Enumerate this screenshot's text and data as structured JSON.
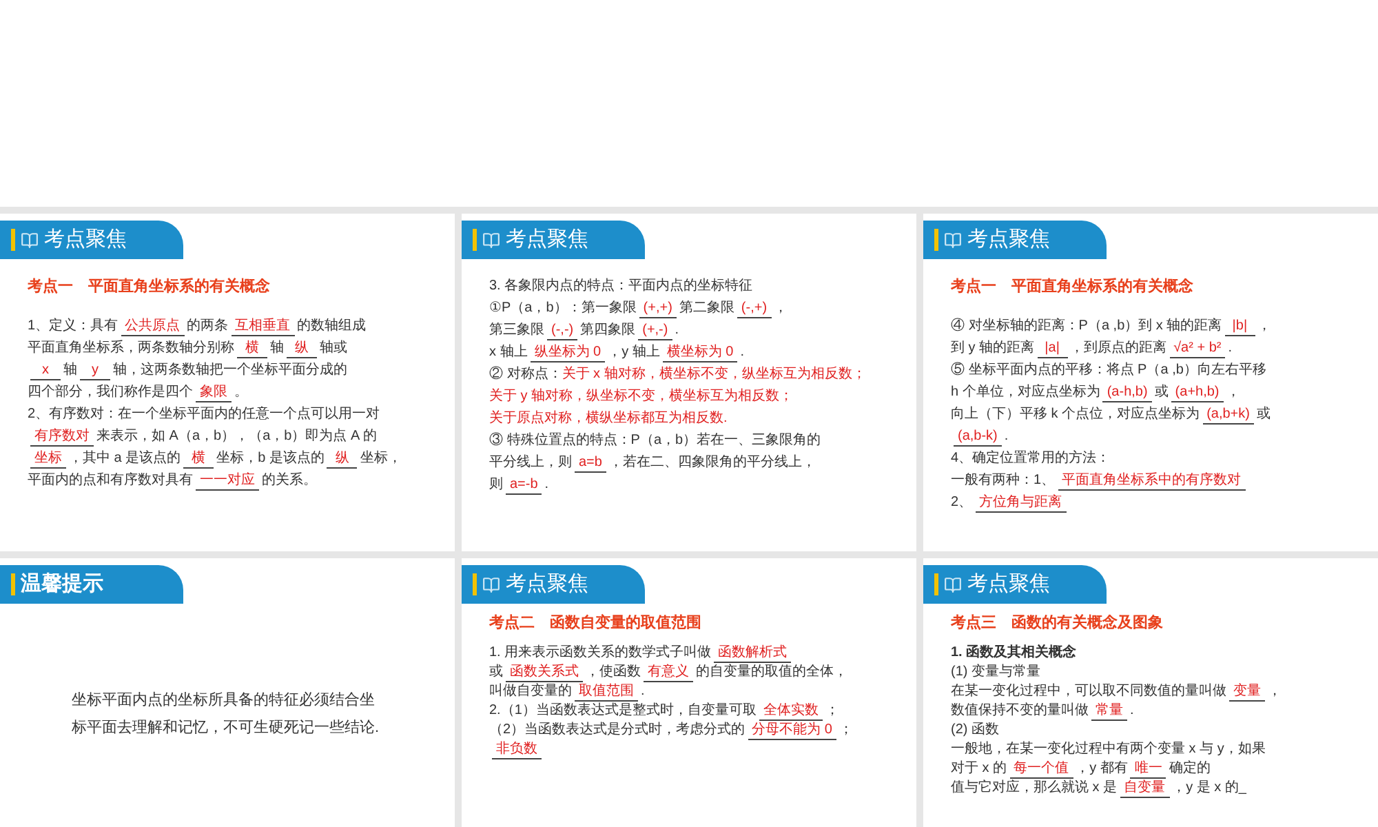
{
  "slides": [
    {
      "title": "考点聚焦",
      "book_icon": true,
      "subtitle": "考点一　平面直角坐标系的有关概念",
      "lines": [
        {
          "segments": [
            {
              "kind": "text",
              "text": "1、定义：具有"
            },
            {
              "kind": "blank",
              "answer": "公共原点"
            },
            {
              "kind": "text",
              "text": "的两条"
            },
            {
              "kind": "blank",
              "answer": "互相垂直"
            },
            {
              "kind": "text",
              "text": "的数轴组成"
            }
          ]
        },
        {
          "segments": [
            {
              "kind": "text",
              "text": "平面直角坐标系，两条数轴分别称"
            },
            {
              "kind": "blank",
              "answer": "横"
            },
            {
              "kind": "text",
              "text": "轴"
            },
            {
              "kind": "blank",
              "answer": "纵"
            },
            {
              "kind": "text",
              "text": "轴或"
            }
          ]
        },
        {
          "segments": [
            {
              "kind": "blank",
              "answer": "x"
            },
            {
              "kind": "text",
              "text": "轴"
            },
            {
              "kind": "blank",
              "answer": "y"
            },
            {
              "kind": "text",
              "text": "轴，这两条数轴把一个坐标平面分成的"
            }
          ]
        },
        {
          "segments": [
            {
              "kind": "text",
              "text": "四个部分，我们称作是四个"
            },
            {
              "kind": "blank",
              "answer": "象限"
            },
            {
              "kind": "text",
              "text": "。"
            }
          ]
        },
        {
          "segments": [
            {
              "kind": "text",
              "text": "2、有序数对：在一个坐标平面内的任意一个点可以用一对"
            }
          ]
        },
        {
          "segments": [
            {
              "kind": "blank",
              "answer": "有序数对"
            },
            {
              "kind": "text",
              "text": "来表示，如 A（a，b），（a，b）即为点 A 的"
            }
          ]
        },
        {
          "segments": [
            {
              "kind": "blank",
              "answer": "坐标"
            },
            {
              "kind": "text",
              "text": "，其中 a 是该点的"
            },
            {
              "kind": "blank",
              "answer": "横"
            },
            {
              "kind": "text",
              "text": "坐标，b 是该点的"
            },
            {
              "kind": "blank",
              "answer": "纵"
            },
            {
              "kind": "text",
              "text": "坐标，"
            }
          ]
        },
        {
          "segments": [
            {
              "kind": "text",
              "text": "平面内的点和有序数对具有"
            },
            {
              "kind": "blank",
              "answer": "一一对应"
            },
            {
              "kind": "text",
              "text": "的关系。"
            }
          ]
        }
      ]
    },
    {
      "title": "考点聚焦",
      "book_icon": true,
      "lines": [
        {
          "segments": [
            {
              "kind": "text",
              "text": "3. 各象限内点的特点：平面内点的坐标特征"
            }
          ]
        },
        {
          "segments": [
            {
              "kind": "text",
              "text": "①P（a，b）：第一象限"
            },
            {
              "kind": "blank",
              "answer": "(+,+)"
            },
            {
              "kind": "text",
              "text": "第二象限"
            },
            {
              "kind": "blank",
              "answer": "(-,+)"
            },
            {
              "kind": "text",
              "text": "，"
            }
          ]
        },
        {
          "segments": [
            {
              "kind": "text",
              "text": "第三象限"
            },
            {
              "kind": "blank",
              "answer": "(-,-)"
            },
            {
              "kind": "text",
              "text": "第四象限"
            },
            {
              "kind": "blank",
              "answer": "(+,-)"
            },
            {
              "kind": "text",
              "text": "."
            }
          ]
        },
        {
          "segments": [
            {
              "kind": "text",
              "text": "x 轴上"
            },
            {
              "kind": "blank",
              "answer": "纵坐标为 0"
            },
            {
              "kind": "text",
              "text": "，y 轴上"
            },
            {
              "kind": "blank",
              "answer": "横坐标为 0"
            },
            {
              "kind": "text",
              "text": "."
            }
          ]
        },
        {
          "segments": [
            {
              "kind": "text",
              "text": "② 对称点："
            },
            {
              "kind": "red",
              "text": "关于 x 轴对称，横坐标不变，纵坐标互为相反数；"
            }
          ]
        },
        {
          "segments": [
            {
              "kind": "red",
              "text": "关于 y 轴对称，纵坐标不变，横坐标互为相反数；"
            }
          ]
        },
        {
          "segments": [
            {
              "kind": "red",
              "text": "关于原点对称，横纵坐标都互为相反数."
            }
          ]
        },
        {
          "segments": [
            {
              "kind": "text",
              "text": "③ 特殊位置点的特点：P（a，b）若在一、三象限角的"
            }
          ]
        },
        {
          "segments": [
            {
              "kind": "text",
              "text": "平分线上，则"
            },
            {
              "kind": "blank",
              "answer": "a=b"
            },
            {
              "kind": "text",
              "text": "，若在二、四象限角的平分线上，"
            }
          ]
        },
        {
          "segments": [
            {
              "kind": "text",
              "text": "则"
            },
            {
              "kind": "blank",
              "answer": "a=-b"
            },
            {
              "kind": "text",
              "text": "."
            }
          ]
        }
      ]
    },
    {
      "title": "考点聚焦",
      "book_icon": true,
      "subtitle": "考点一　平面直角坐标系的有关概念",
      "lines": [
        {
          "segments": [
            {
              "kind": "text",
              "text": "④ 对坐标轴的距离：P（a ,b）到 x 轴的距离"
            },
            {
              "kind": "blank",
              "answer": "|b|"
            },
            {
              "kind": "text",
              "text": "，"
            }
          ]
        },
        {
          "segments": [
            {
              "kind": "text",
              "text": "到 y 轴的距离"
            },
            {
              "kind": "blank",
              "answer": "|a|"
            },
            {
              "kind": "text",
              "text": "，到原点的距离"
            },
            {
              "kind": "blank",
              "answer": "√a² + b²"
            },
            {
              "kind": "text",
              "text": "."
            }
          ]
        },
        {
          "segments": [
            {
              "kind": "text",
              "text": "⑤ 坐标平面内点的平移：将点 P（a ,b）向左右平移"
            }
          ]
        },
        {
          "segments": [
            {
              "kind": "text",
              "text": "h 个单位，对应点坐标为"
            },
            {
              "kind": "blank",
              "answer": "(a-h,b)"
            },
            {
              "kind": "text",
              "text": "或"
            },
            {
              "kind": "blank",
              "answer": "(a+h,b)"
            },
            {
              "kind": "text",
              "text": "，"
            }
          ]
        },
        {
          "segments": [
            {
              "kind": "text",
              "text": "向上（下）平移 k 个点位，对应点坐标为"
            },
            {
              "kind": "blank",
              "answer": "(a,b+k)"
            },
            {
              "kind": "text",
              "text": "或"
            }
          ]
        },
        {
          "segments": [
            {
              "kind": "blank",
              "answer": "(a,b-k)"
            },
            {
              "kind": "text",
              "text": "."
            }
          ]
        },
        {
          "segments": [
            {
              "kind": "text",
              "text": "4、确定位置常用的方法："
            }
          ]
        },
        {
          "segments": [
            {
              "kind": "text",
              "text": "一般有两种：1、"
            },
            {
              "kind": "blank",
              "answer": "平面直角坐标系中的有序数对"
            }
          ]
        },
        {
          "segments": [
            {
              "kind": "text",
              "text": "2、"
            },
            {
              "kind": "blank",
              "answer": "方位角与距离"
            }
          ]
        }
      ]
    },
    {
      "title": "温馨提示",
      "book_icon": false,
      "lines": [
        {
          "segments": [
            {
              "kind": "text",
              "text": "坐标平面内点的坐标所具备的特征必须结合坐标平面去理解和记忆，不可生硬死记一些结论."
            }
          ]
        }
      ]
    },
    {
      "title": "考点聚焦",
      "book_icon": true,
      "subtitle": "考点二　函数自变量的取值范围",
      "lines": [
        {
          "segments": [
            {
              "kind": "text",
              "text": "1. 用来表示函数关系的数学式子叫做"
            },
            {
              "kind": "blank",
              "answer": "函数解析式"
            }
          ]
        },
        {
          "segments": [
            {
              "kind": "text",
              "text": "或"
            },
            {
              "kind": "blank",
              "answer": "函数关系式"
            },
            {
              "kind": "text",
              "text": "，使函数"
            },
            {
              "kind": "blank",
              "answer": "有意义"
            },
            {
              "kind": "text",
              "text": "的自变量的取值的全体，"
            }
          ]
        },
        {
          "segments": [
            {
              "kind": "text",
              "text": "叫做自变量的"
            },
            {
              "kind": "blank",
              "answer": "取值范围"
            },
            {
              "kind": "text",
              "text": "."
            }
          ]
        },
        {
          "segments": [
            {
              "kind": "text",
              "text": "2.（1）当函数表达式是整式时，自变量可取"
            },
            {
              "kind": "blank",
              "answer": "全体实数"
            },
            {
              "kind": "text",
              "text": "；"
            }
          ]
        },
        {
          "segments": [
            {
              "kind": "text",
              "text": "（2）当函数表达式是分式时，考虑分式的"
            },
            {
              "kind": "blank",
              "answer": "分母不能为 0"
            },
            {
              "kind": "text",
              "text": "；"
            }
          ]
        },
        {
          "segments": [
            {
              "kind": "blank",
              "answer": "非负数"
            }
          ]
        }
      ]
    },
    {
      "title": "考点聚焦",
      "book_icon": true,
      "subtitle": "考点三　函数的有关概念及图象",
      "lines": [
        {
          "bold": true,
          "segments": [
            {
              "kind": "text",
              "text": "1. 函数及其相关概念"
            }
          ]
        },
        {
          "segments": [
            {
              "kind": "text",
              "text": "(1) 变量与常量"
            }
          ]
        },
        {
          "segments": [
            {
              "kind": "text",
              "text": "在某一变化过程中，可以取不同数值的量叫做"
            },
            {
              "kind": "blank",
              "answer": "变量"
            },
            {
              "kind": "text",
              "text": "，"
            }
          ]
        },
        {
          "segments": [
            {
              "kind": "text",
              "text": "数值保持不变的量叫做"
            },
            {
              "kind": "blank",
              "answer": "常量"
            },
            {
              "kind": "text",
              "text": "."
            }
          ]
        },
        {
          "segments": [
            {
              "kind": "text",
              "text": "(2) 函数"
            }
          ]
        },
        {
          "segments": [
            {
              "kind": "text",
              "text": "一般地，在某一变化过程中有两个变量 x 与 y，如果"
            }
          ]
        },
        {
          "segments": [
            {
              "kind": "text",
              "text": "对于 x 的"
            },
            {
              "kind": "blank",
              "answer": "每一个值"
            },
            {
              "kind": "text",
              "text": "，y 都有"
            },
            {
              "kind": "blank",
              "answer": "唯一"
            },
            {
              "kind": "text",
              "text": "确定的"
            }
          ]
        },
        {
          "segments": [
            {
              "kind": "text",
              "text": "值与它对应，那么就说 x 是"
            },
            {
              "kind": "blank",
              "answer": "自变量"
            },
            {
              "kind": "text",
              "text": "，y 是 x 的_"
            }
          ]
        }
      ]
    }
  ]
}
